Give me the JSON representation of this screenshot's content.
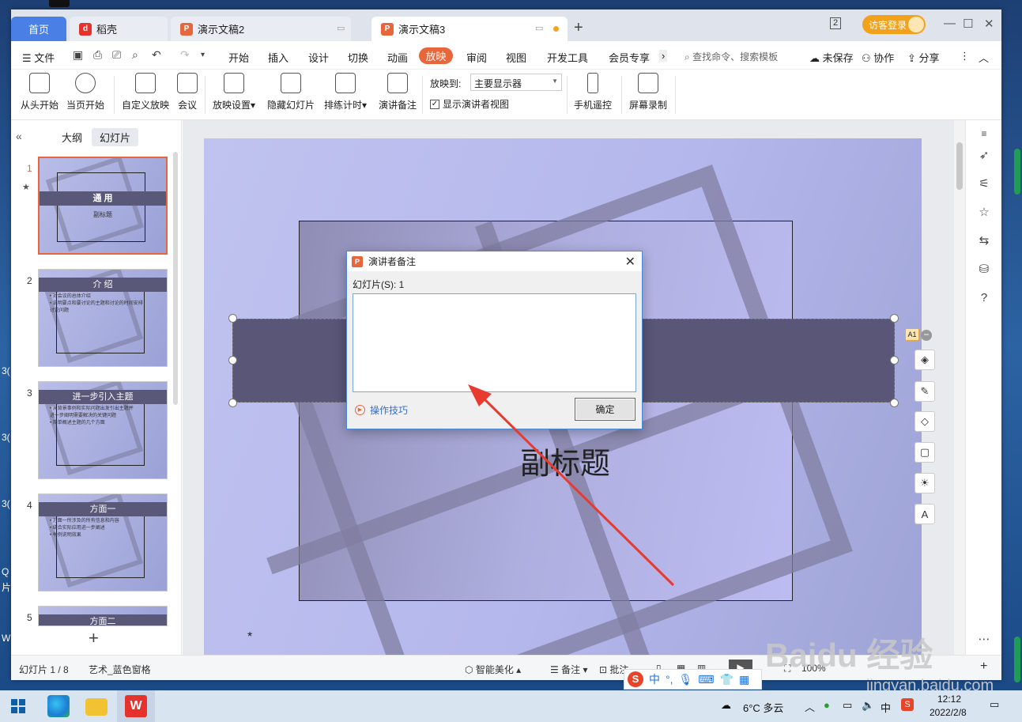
{
  "desktop": {
    "side_labels": [
      "3(",
      "3(",
      "3(",
      "Q",
      "片",
      "W"
    ]
  },
  "titlebar": {
    "tabs": [
      {
        "label": "首页"
      },
      {
        "label": "稻壳"
      },
      {
        "label": "演示文稿2"
      },
      {
        "label": "演示文稿3"
      }
    ],
    "window_count": "2",
    "login_label": "访客登录"
  },
  "menubar": {
    "file_label": "文件",
    "items": [
      "开始",
      "插入",
      "设计",
      "切换",
      "动画",
      "放映",
      "审阅",
      "视图",
      "开发工具",
      "会员专享"
    ],
    "active_item": "放映",
    "search_placeholder": "查找命令、搜索模板",
    "unsaved_label": "未保存",
    "collab_label": "协作",
    "share_label": "分享"
  },
  "ribbon": {
    "buttons": {
      "from_start": "从头开始",
      "from_current": "当页开始",
      "custom_show": "自定义放映",
      "meeting": "会议",
      "show_settings": "放映设置",
      "hide_slide": "隐藏幻灯片",
      "rehearse": "排练计时",
      "speaker_notes": "演讲备注",
      "phone_remote": "手机遥控",
      "screen_record": "屏幕录制"
    },
    "project_to_label": "放映到:",
    "project_to_value": "主要显示器",
    "presenter_view_label": "显示演讲者视图",
    "presenter_view_checked": true
  },
  "left_panel": {
    "tab_outline": "大纲",
    "tab_slides": "幻灯片",
    "slides": [
      {
        "num": "1",
        "title": "通 用",
        "subtitle": "副标题",
        "lines": []
      },
      {
        "num": "2",
        "title": "介 绍",
        "subtitle": "",
        "lines": [
          "• 对会议的总体介绍",
          "• 说明要点和要讨论的主题和讨论的时间安排",
          "  讨论问题"
        ]
      },
      {
        "num": "3",
        "title": "进一步引入主题",
        "subtitle": "",
        "lines": [
          "• 从背景事例和实际问题出发引出主题并",
          "  进一步阐明需要解决的关键问题",
          "• 简单概述主题的几个方面"
        ]
      },
      {
        "num": "4",
        "title": "方面一",
        "subtitle": "",
        "lines": [
          "• 方面一所涉及的所有信息和内容",
          "• 结合实际应用进一步阐述",
          "• 举例说明效果"
        ]
      },
      {
        "num": "5",
        "title": "方面二",
        "subtitle": "",
        "lines": []
      }
    ]
  },
  "slide": {
    "subtitle": "副标题",
    "notes_marker": "*",
    "a1_badge": "A1"
  },
  "dialog": {
    "title": "演讲者备注",
    "slide_label": "幻灯片(S): 1",
    "notes_text": "",
    "tips_label": "操作技巧",
    "ok_label": "确定"
  },
  "statusbar": {
    "slide_info": "幻灯片 1 / 8",
    "theme": "艺术_蓝色窗格",
    "smart_beautify": "智能美化",
    "notes": "备注",
    "comments": "批注",
    "zoom": "100%"
  },
  "ime": {
    "mode": "中"
  },
  "taskbar": {
    "weather": "6°C  多云",
    "lang": "中",
    "time": "12:12",
    "date": "2022/2/8"
  },
  "watermark": {
    "brand": "Baidu 经验",
    "url": "jingyan.baidu.com"
  },
  "colors": {
    "accent": "#e8663b",
    "home_tab": "#4a7fe5",
    "title_band": "#595678",
    "login": "#f2a11b"
  }
}
